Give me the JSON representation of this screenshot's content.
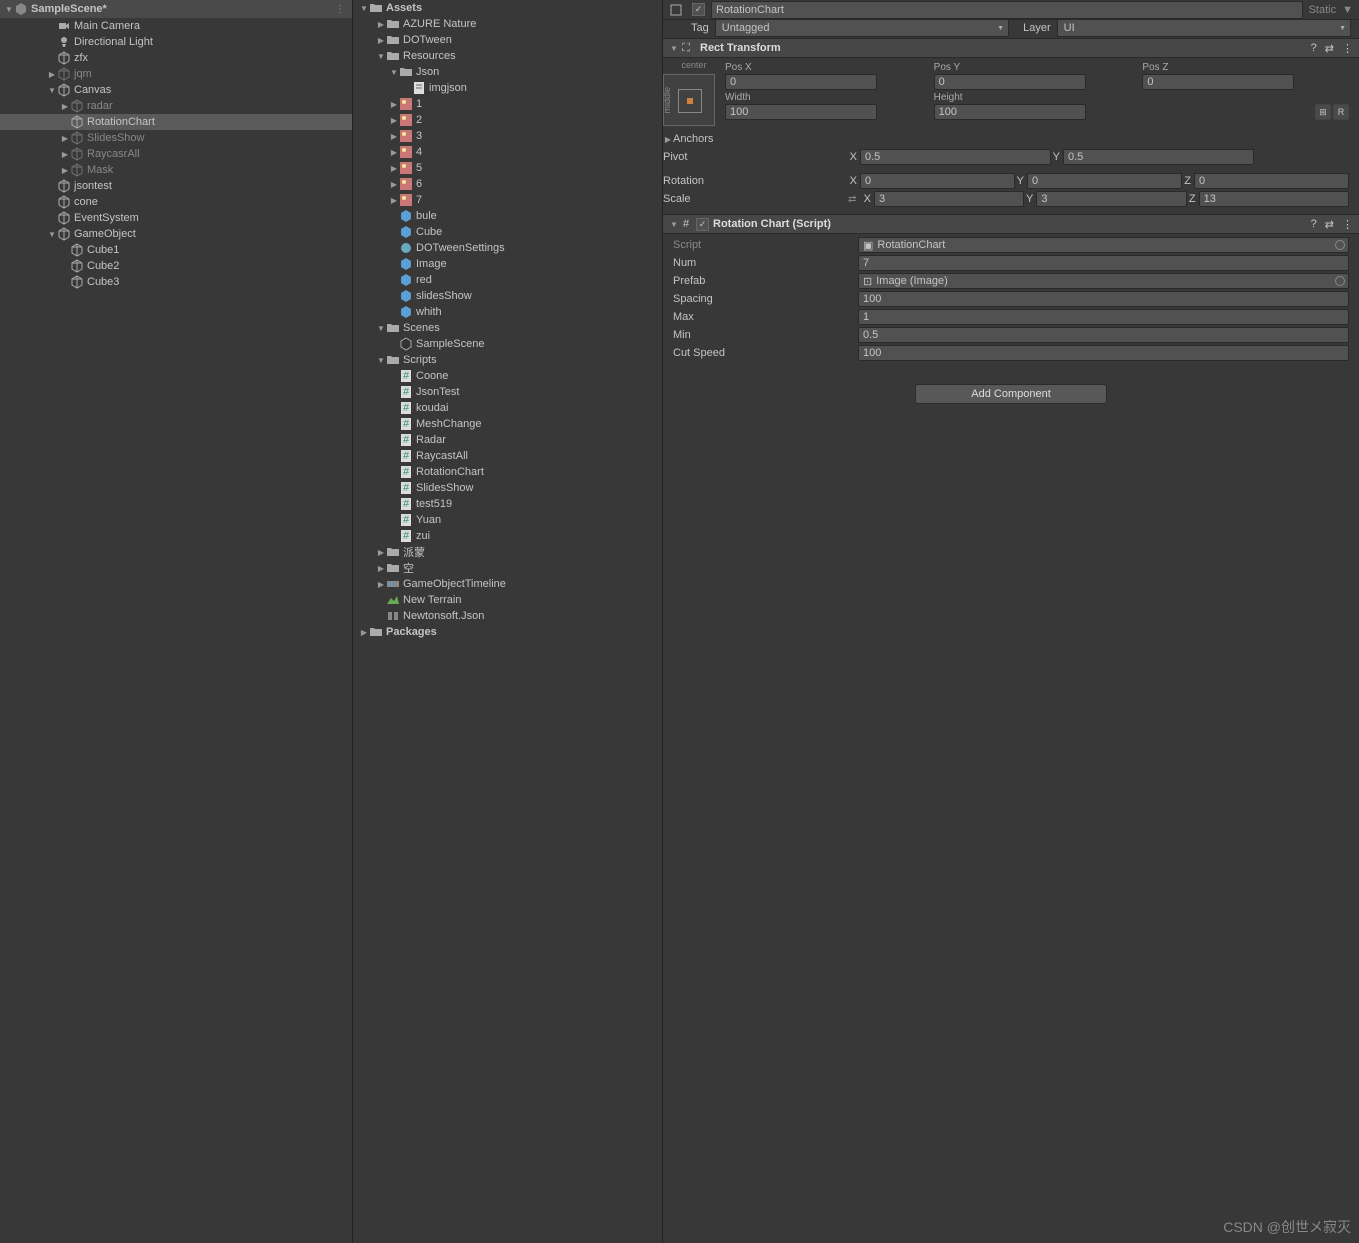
{
  "watermark": "CSDN @创世メ寂灭",
  "hierarchy": {
    "root": "SampleScene*",
    "items": [
      {
        "depth": 1,
        "icon": "camera",
        "label": "Main Camera"
      },
      {
        "depth": 1,
        "icon": "light",
        "label": "Directional Light"
      },
      {
        "depth": 1,
        "icon": "cube",
        "label": "zfx"
      },
      {
        "depth": 1,
        "icon": "cube",
        "label": "jqm",
        "fold": "▶",
        "dim": true
      },
      {
        "depth": 1,
        "icon": "cube",
        "label": "Canvas",
        "fold": "▼"
      },
      {
        "depth": 2,
        "icon": "cube",
        "label": "radar",
        "fold": "▶",
        "dim": true
      },
      {
        "depth": 2,
        "icon": "cube",
        "label": "RotationChart",
        "selected": true
      },
      {
        "depth": 2,
        "icon": "cube",
        "label": "SlidesShow",
        "fold": "▶",
        "dim": true
      },
      {
        "depth": 2,
        "icon": "cube",
        "label": "RaycasrAll",
        "fold": "▶",
        "dim": true
      },
      {
        "depth": 2,
        "icon": "cube",
        "label": "Mask",
        "fold": "▶",
        "dim": true
      },
      {
        "depth": 1,
        "icon": "cube",
        "label": "jsontest"
      },
      {
        "depth": 1,
        "icon": "cube",
        "label": "cone"
      },
      {
        "depth": 1,
        "icon": "cube",
        "label": "EventSystem"
      },
      {
        "depth": 1,
        "icon": "cube",
        "label": "GameObject",
        "fold": "▼"
      },
      {
        "depth": 2,
        "icon": "cube",
        "label": "Cube1"
      },
      {
        "depth": 2,
        "icon": "cube",
        "label": "Cube2"
      },
      {
        "depth": 2,
        "icon": "cube",
        "label": "Cube3"
      }
    ]
  },
  "project": {
    "root": "Assets",
    "items": [
      {
        "depth": 1,
        "fold": "▶",
        "icon": "folder",
        "label": "AZURE Nature"
      },
      {
        "depth": 1,
        "fold": "▶",
        "icon": "folder",
        "label": "DOTween"
      },
      {
        "depth": 1,
        "fold": "▼",
        "icon": "folder",
        "label": "Resources"
      },
      {
        "depth": 2,
        "fold": "▼",
        "icon": "folder",
        "label": "Json"
      },
      {
        "depth": 3,
        "icon": "text",
        "label": "imgjson"
      },
      {
        "depth": 2,
        "fold": "▶",
        "icon": "sprite",
        "label": "1"
      },
      {
        "depth": 2,
        "fold": "▶",
        "icon": "sprite",
        "label": "2"
      },
      {
        "depth": 2,
        "fold": "▶",
        "icon": "sprite",
        "label": "3"
      },
      {
        "depth": 2,
        "fold": "▶",
        "icon": "sprite",
        "label": "4"
      },
      {
        "depth": 2,
        "fold": "▶",
        "icon": "sprite",
        "label": "5"
      },
      {
        "depth": 2,
        "fold": "▶",
        "icon": "sprite",
        "label": "6"
      },
      {
        "depth": 2,
        "fold": "▶",
        "icon": "sprite",
        "label": "7"
      },
      {
        "depth": 2,
        "icon": "prefab",
        "label": "bule"
      },
      {
        "depth": 2,
        "icon": "prefab",
        "label": "Cube"
      },
      {
        "depth": 2,
        "icon": "asset",
        "label": "DOTweenSettings"
      },
      {
        "depth": 2,
        "icon": "prefab",
        "label": "Image"
      },
      {
        "depth": 2,
        "icon": "prefab",
        "label": "red"
      },
      {
        "depth": 2,
        "icon": "prefab",
        "label": "slidesShow"
      },
      {
        "depth": 2,
        "icon": "prefab",
        "label": "whith"
      },
      {
        "depth": 1,
        "fold": "▼",
        "icon": "folder",
        "label": "Scenes"
      },
      {
        "depth": 2,
        "icon": "scene",
        "label": "SampleScene"
      },
      {
        "depth": 1,
        "fold": "▼",
        "icon": "folder",
        "label": "Scripts"
      },
      {
        "depth": 2,
        "icon": "cs",
        "label": "Coone"
      },
      {
        "depth": 2,
        "icon": "cs",
        "label": "JsonTest"
      },
      {
        "depth": 2,
        "icon": "cs",
        "label": "koudai"
      },
      {
        "depth": 2,
        "icon": "cs",
        "label": "MeshChange"
      },
      {
        "depth": 2,
        "icon": "cs",
        "label": "Radar"
      },
      {
        "depth": 2,
        "icon": "cs",
        "label": "RaycastAll"
      },
      {
        "depth": 2,
        "icon": "cs",
        "label": "RotationChart"
      },
      {
        "depth": 2,
        "icon": "cs",
        "label": "SlidesShow"
      },
      {
        "depth": 2,
        "icon": "cs",
        "label": "test519"
      },
      {
        "depth": 2,
        "icon": "cs",
        "label": "Yuan"
      },
      {
        "depth": 2,
        "icon": "cs",
        "label": "zui"
      },
      {
        "depth": 1,
        "fold": "▶",
        "icon": "folder",
        "label": "派蒙"
      },
      {
        "depth": 1,
        "fold": "▶",
        "icon": "folder",
        "label": "空"
      },
      {
        "depth": 1,
        "fold": "▶",
        "icon": "timeline",
        "label": "GameObjectTimeline"
      },
      {
        "depth": 1,
        "icon": "terrain",
        "label": "New Terrain"
      },
      {
        "depth": 1,
        "icon": "dll",
        "label": "Newtonsoft.Json"
      }
    ],
    "packages": "Packages"
  },
  "inspector": {
    "name": "RotationChart",
    "static_label": "Static",
    "tag_label": "Tag",
    "tag_value": "Untagged",
    "layer_label": "Layer",
    "layer_value": "UI",
    "rect_transform": {
      "title": "Rect Transform",
      "anchor_label": "center",
      "middle_label": "middle",
      "posx_label": "Pos X",
      "posx": "0",
      "posy_label": "Pos Y",
      "posy": "0",
      "posz_label": "Pos Z",
      "posz": "0",
      "width_label": "Width",
      "width": "100",
      "height_label": "Height",
      "height": "100",
      "anchors_label": "Anchors",
      "pivot_label": "Pivot",
      "pivot_x": "0.5",
      "pivot_y": "0.5",
      "rotation_label": "Rotation",
      "rot_x": "0",
      "rot_y": "0",
      "rot_z": "0",
      "scale_label": "Scale",
      "scl_x": "3",
      "scl_y": "3",
      "scl_z": "13"
    },
    "rotation_chart": {
      "title": "Rotation Chart (Script)",
      "script_label": "Script",
      "script_value": "RotationChart",
      "num_label": "Num",
      "num": "7",
      "prefab_label": "Prefab",
      "prefab": "Image (Image)",
      "spacing_label": "Spacing",
      "spacing": "100",
      "max_label": "Max",
      "max": "1",
      "min_label": "Min",
      "min": "0.5",
      "cutspeed_label": "Cut Speed",
      "cutspeed": "100"
    },
    "add_component": "Add Component"
  }
}
